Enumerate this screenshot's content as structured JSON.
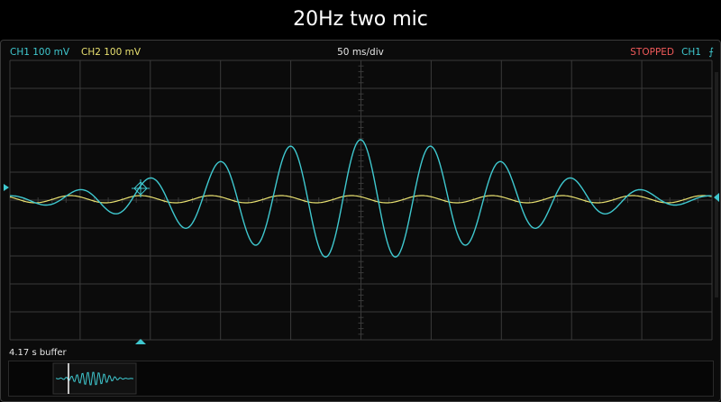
{
  "title": "20Hz two mic",
  "header": {
    "ch1_label": "CH1 100 mV",
    "ch2_label": "CH2 100 mV",
    "timebase": "50 ms/div",
    "status": "STOPPED",
    "trigger_channel": "CH1",
    "trigger_icon": "rising-edge-icon"
  },
  "buffer": {
    "label": "4.17 s buffer"
  },
  "colors": {
    "ch1": "#3fc8cf",
    "ch2": "#e8e070",
    "status": "#f05a5a",
    "grid": "#3a3a3a",
    "background": "#0b0b0b"
  }
}
